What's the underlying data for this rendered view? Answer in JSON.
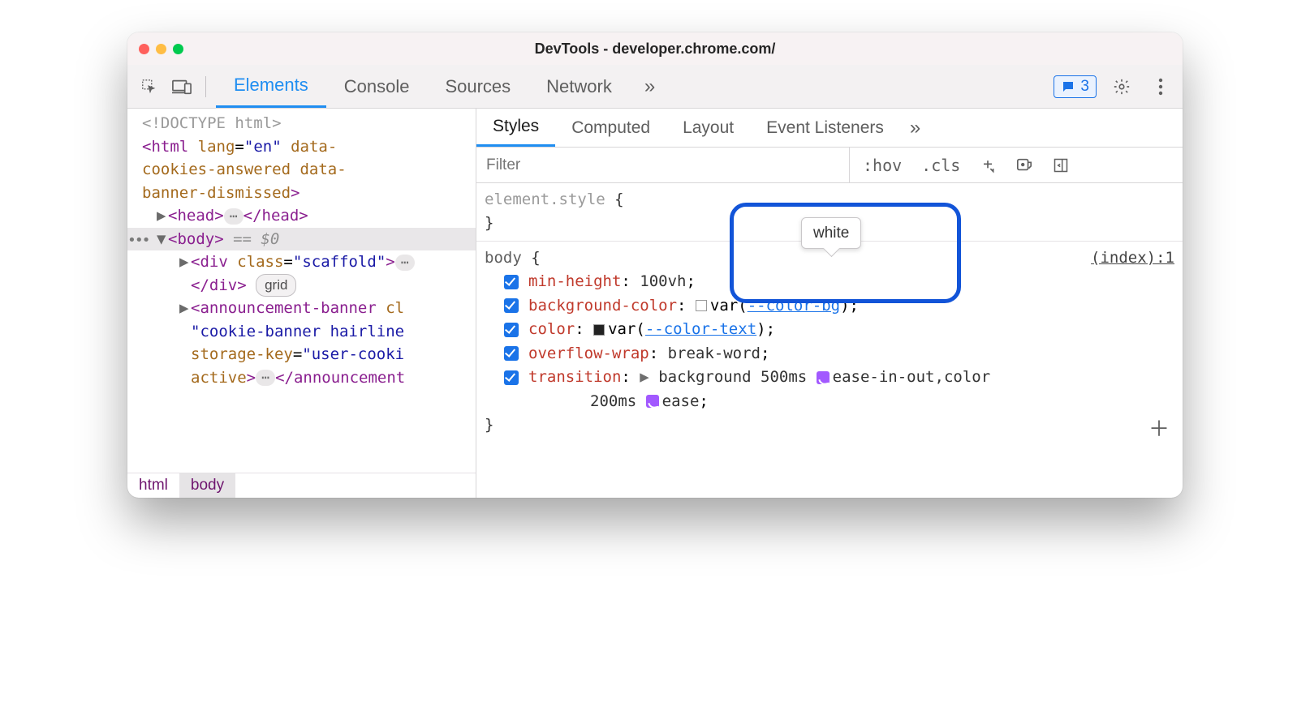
{
  "title": "DevTools - developer.chrome.com/",
  "bubble_count": "3",
  "main_tabs": [
    "Elements",
    "Console",
    "Sources",
    "Network"
  ],
  "main_tabs_active_index": 0,
  "sub_tabs": [
    "Styles",
    "Computed",
    "Layout",
    "Event Listeners"
  ],
  "sub_tabs_active_index": 0,
  "filter_placeholder": "Filter",
  "filter_tools": {
    "hov": ":hov",
    "cls": ".cls"
  },
  "breadcrumbs": [
    "html",
    "body"
  ],
  "breadcrumbs_active_index": 1,
  "dom": {
    "doctype": "<!DOCTYPE html>",
    "html_open_1": "<html lang=\"en\" data-",
    "html_open_2": "cookies-answered data-",
    "html_open_3": "banner-dismissed>",
    "head": {
      "open": "<head>",
      "close": "</head>"
    },
    "body_open": "<body>",
    "body_eq": "== $0",
    "div_line": "<div class=\"scaffold\">",
    "div_close": "</div>",
    "grid_chip": "grid",
    "ann_line1": "<announcement-banner cl",
    "ann_line2": "\"cookie-banner hairline",
    "ann_line3": "storage-key=\"user-cooki",
    "ann_line4_a": "active>",
    "ann_close": "</announcement"
  },
  "rules": {
    "element_style": "element.style",
    "body": {
      "selector": "body",
      "source": "(index):1",
      "props": [
        {
          "name": "min-height",
          "value": "100vh"
        },
        {
          "name": "background-color",
          "var": "--color-bg",
          "swatch": "white"
        },
        {
          "name": "color",
          "var": "--color-text",
          "swatch": "dark"
        },
        {
          "name": "overflow-wrap",
          "value": "break-word"
        },
        {
          "name": "transition",
          "parts": {
            "pre": "background 500ms",
            "ease1": "ease-in-out",
            "mid": ",color",
            "time2": "200ms",
            "ease2": "ease"
          }
        }
      ]
    }
  },
  "tooltip_text": "white"
}
